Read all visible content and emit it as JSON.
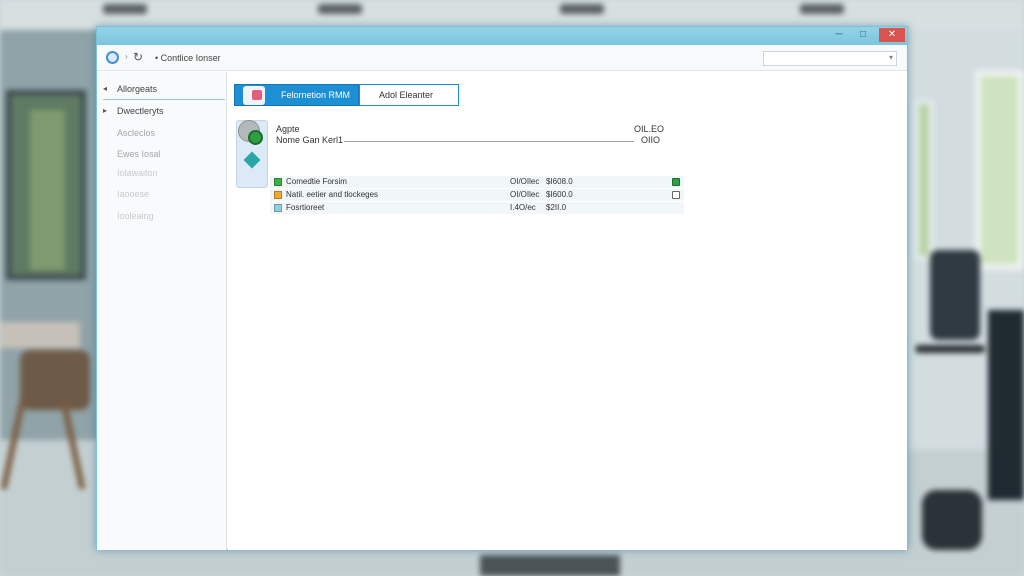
{
  "window": {
    "title": "",
    "close_symbol": "✕",
    "maximize_symbol": "□",
    "minimize_symbol": "─"
  },
  "address_bar": {
    "path": "• Contlice Ionser",
    "search_placeholder": ""
  },
  "sidebar": {
    "items": [
      {
        "label": "Allorgeats"
      },
      {
        "label": "Dwectleryts"
      },
      {
        "label": "Ascleclos"
      },
      {
        "label": "Ewes Iosal"
      },
      {
        "label": "Iolawaiton"
      },
      {
        "label": "Iaooese"
      },
      {
        "label": "Iooleaing"
      }
    ]
  },
  "tabs": {
    "primary": "Felornetion RMM",
    "secondary": "Adol Eleanter"
  },
  "details": {
    "header_label": "Agpte",
    "header_value": "OIL.EO",
    "name_label": "Nome Gan Kerl1",
    "name_value": "OIIO"
  },
  "rows": [
    {
      "name": "Comedtie Forsim",
      "rate": "OI/OIlec",
      "amount": "$I608.0",
      "color": "#3cb043",
      "checked": true
    },
    {
      "name": "Natil. eetier and tlockeges",
      "rate": "OI/OIlec",
      "amount": "$I600.0",
      "color": "#f0a830",
      "checked": false
    },
    {
      "name": "Fosrtioreet",
      "rate": "I.4O/ec",
      "amount": "$2II.0",
      "color": "#8fd0e0",
      "checked": null
    }
  ],
  "icons": {
    "back": "back-arrow-icon",
    "refresh": "refresh-icon",
    "avatar": "user-avatar-icon",
    "tag": "diamond-tag-icon"
  },
  "colors": {
    "accent": "#1d8fd4",
    "titlebar": "#7cc5dc",
    "close": "#d9534f"
  }
}
